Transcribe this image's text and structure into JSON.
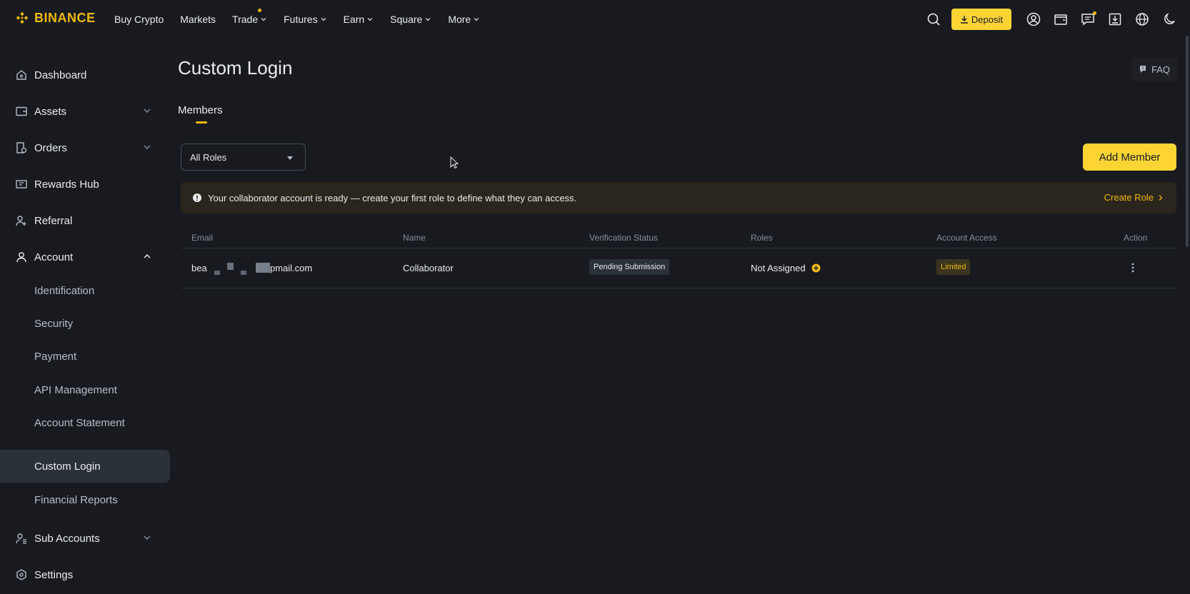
{
  "brand": {
    "name": "BINANCE",
    "color": "#f0b90b"
  },
  "nav": {
    "items": [
      {
        "label": "Buy Crypto",
        "dropdown": false
      },
      {
        "label": "Markets",
        "dropdown": false
      },
      {
        "label": "Trade",
        "dropdown": true
      },
      {
        "label": "Futures",
        "dropdown": true
      },
      {
        "label": "Earn",
        "dropdown": true
      },
      {
        "label": "Square",
        "dropdown": true
      },
      {
        "label": "More",
        "dropdown": true
      }
    ],
    "deposit_label": "Deposit"
  },
  "sidebar": {
    "items": [
      {
        "label": "Dashboard",
        "icon": "home-icon"
      },
      {
        "label": "Assets",
        "icon": "wallet-icon"
      },
      {
        "label": "Orders",
        "icon": "orders-icon"
      },
      {
        "label": "Rewards Hub",
        "icon": "ticket-icon"
      },
      {
        "label": "Referral",
        "icon": "user-plus-icon"
      },
      {
        "label": "Account",
        "icon": "user-icon"
      }
    ],
    "account_sub": [
      "Identification",
      "Security",
      "Payment",
      "API Management",
      "Account Statement",
      "Custom Login",
      "Financial Reports"
    ],
    "active_sub": "Custom Login",
    "bottom_items": [
      {
        "label": "Sub Accounts",
        "icon": "sub-accounts-icon"
      },
      {
        "label": "Settings",
        "icon": "settings-icon"
      }
    ]
  },
  "main": {
    "title": "Custom Login",
    "faq_label": "FAQ",
    "tab": "Members",
    "role_filter": "All Roles",
    "add_member_label": "Add Member",
    "notice": {
      "text": "Your collaborator account is ready — create your first role to define what they can access.",
      "action": "Create Role"
    },
    "table": {
      "headers": [
        "Email",
        "Name",
        "Verification Status",
        "Roles",
        "Account Access",
        "Action"
      ],
      "rows": [
        {
          "email_prefix": "bea",
          "email_suffix": "pmail.com",
          "name": "Collaborator",
          "verification": "Pending Submission",
          "roles": "Not Assigned",
          "access": "Limited"
        }
      ]
    }
  },
  "colors": {
    "background": "#181a20",
    "accent": "#fcd535",
    "text": "#eaecef",
    "muted": "#848e9c"
  }
}
